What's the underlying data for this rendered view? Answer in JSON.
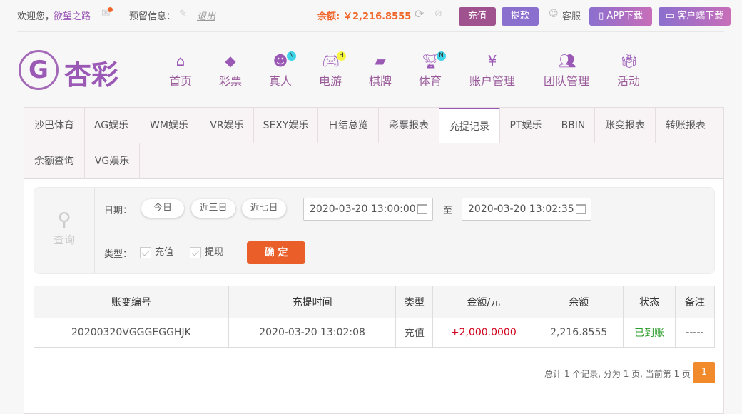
{
  "topbar": {
    "welcome": "欢迎您，",
    "username": "欲望之路",
    "reserved_info": "预留信息：",
    "logout": "退出",
    "balance_label": "余额:",
    "balance_value": "￥2,216.8555",
    "deposit": "充值",
    "withdraw": "提款",
    "service": "客服",
    "app_download": "APP下载",
    "client_download": "客户端下载"
  },
  "logo": {
    "text": "杏彩"
  },
  "nav": [
    {
      "label": "首页",
      "icon": "home-icon"
    },
    {
      "label": "彩票",
      "icon": "ticket-icon"
    },
    {
      "label": "真人",
      "icon": "dealer-icon",
      "badge": "N"
    },
    {
      "label": "电游",
      "icon": "gamepad-icon",
      "badge": "H"
    },
    {
      "label": "棋牌",
      "icon": "cards-icon"
    },
    {
      "label": "体育",
      "icon": "trophy-icon",
      "badge": "N"
    },
    {
      "label": "账户管理",
      "icon": "yen-icon"
    },
    {
      "label": "团队管理",
      "icon": "team-icon"
    },
    {
      "label": "活动",
      "icon": "gift-icon"
    }
  ],
  "tabs": [
    "沙巴体育",
    "AG娱乐",
    "WM娱乐",
    "VR娱乐",
    "SEXY娱乐",
    "日结总览",
    "彩票报表",
    "充提记录",
    "PT娱乐",
    "BBIN",
    "账变报表",
    "转账报表",
    "余额查询",
    "VG娱乐"
  ],
  "active_tab": "充提记录",
  "search": {
    "label": "查询",
    "date_label": "日期：",
    "today": "今日",
    "three_days": "近三日",
    "seven_days": "近七日",
    "start": "2020-03-20 13:00:00",
    "to": "至",
    "end": "2020-03-20 13:02:35",
    "type_label": "类型：",
    "type_deposit": "充值",
    "type_withdraw": "提现",
    "confirm": "确 定"
  },
  "table": {
    "headers": [
      "账变编号",
      "充提时间",
      "类型",
      "金额/元",
      "余额",
      "状态",
      "备注"
    ],
    "rows": [
      [
        "20200320VGGGEGGHJK",
        "2020-03-20 13:02:08",
        "充值",
        "+2,000.0000",
        "2,216.8555",
        "已到账",
        "-----"
      ]
    ]
  },
  "pagination": {
    "summary": "总计 1 个记录, 分为 1 页, 当前第 1 页",
    "current": "1"
  },
  "colors": {
    "accent": "#9b59b6",
    "orange": "#f0662a",
    "amount": "#d0021b",
    "status": "#2e9e2e"
  }
}
